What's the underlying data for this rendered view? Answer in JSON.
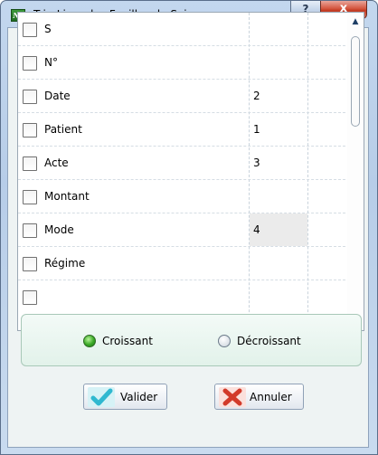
{
  "window": {
    "title": "Tri - Livre des Feuilles de Soins",
    "app_icon_text": "Nr",
    "help_label": "?",
    "close_label": "x"
  },
  "sort_list": {
    "rows": [
      {
        "label": "S",
        "order": "",
        "checked": false
      },
      {
        "label": "N°",
        "order": "",
        "checked": false
      },
      {
        "label": "Date",
        "order": "2",
        "checked": false
      },
      {
        "label": "Patient",
        "order": "1",
        "checked": false
      },
      {
        "label": "Acte",
        "order": "3",
        "checked": false
      },
      {
        "label": "Montant",
        "order": "",
        "checked": false
      },
      {
        "label": "Mode",
        "order": "4",
        "checked": false
      },
      {
        "label": "Régime",
        "order": "",
        "checked": false
      }
    ]
  },
  "order_group": {
    "ascending_label": "Croissant",
    "descending_label": "Décroissant",
    "selected": "ascending"
  },
  "buttons": {
    "validate_label": "Valider",
    "cancel_label": "Annuler"
  },
  "colors": {
    "validate_check": "#2fb8d0",
    "cancel_x": "#d23a2a",
    "radio_selected": "#3aa826"
  }
}
